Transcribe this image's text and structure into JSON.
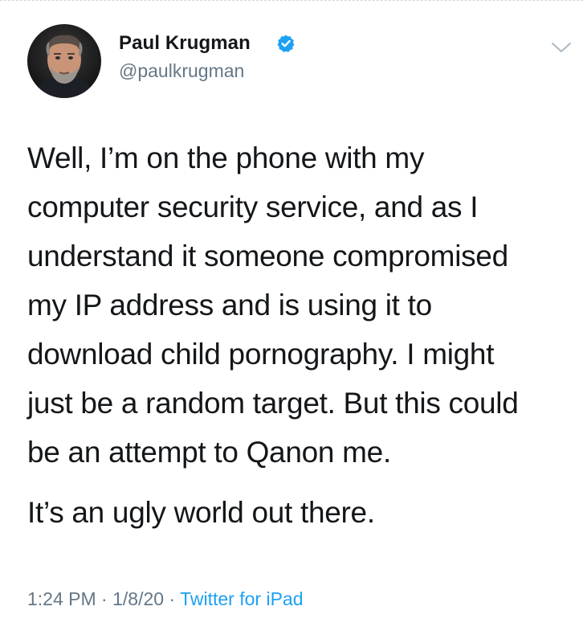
{
  "author": {
    "display_name": "Paul Krugman",
    "handle": "@paulkrugman",
    "verified": true,
    "avatar_icon": "profile-photo"
  },
  "tweet": {
    "lines": [
      "Well, I’m on the phone with my",
      "computer security service, and as I",
      "understand it someone compromised",
      "my IP address and is using it to",
      "download child pornography. I might",
      "just be a random target. But this could",
      "be an attempt to Qanon me."
    ],
    "second_paragraph": "It’s an ugly world out there."
  },
  "meta": {
    "time": "1:24 PM",
    "separator": "·",
    "date": "1/8/20",
    "source": "Twitter for iPad"
  },
  "colors": {
    "text": "#14171a",
    "secondary": "#657786",
    "link": "#1da1f2",
    "verified_badge": "#1da1f2"
  },
  "icons": {
    "verified": "verified-badge-icon",
    "menu": "chevron-down-icon"
  }
}
